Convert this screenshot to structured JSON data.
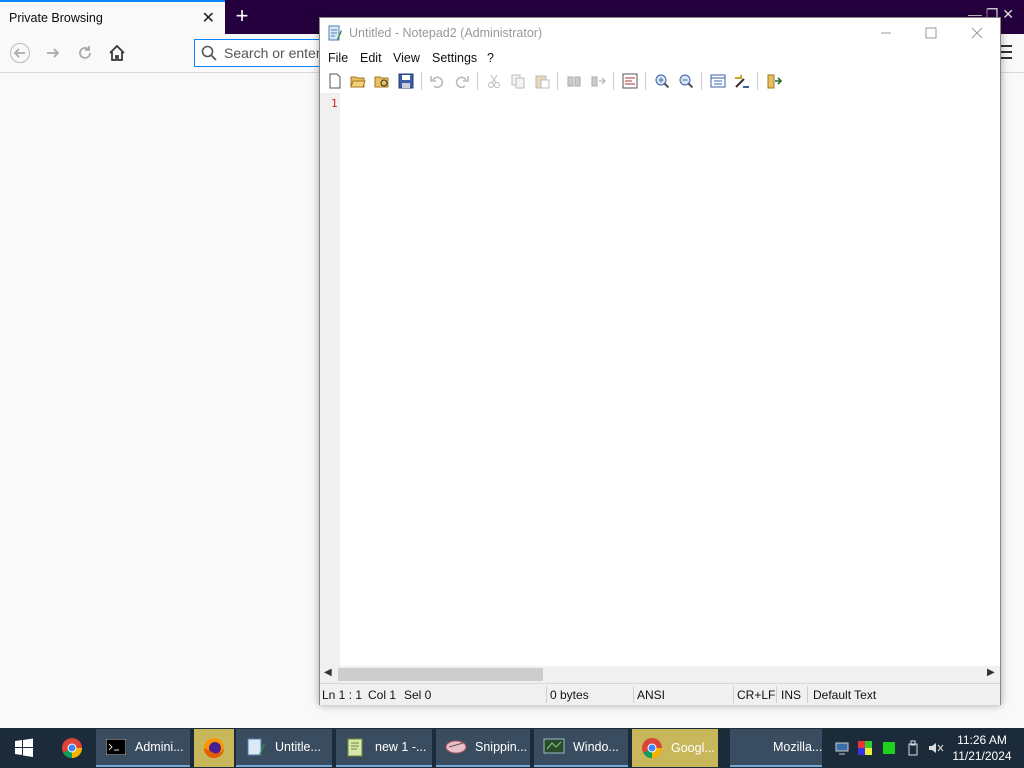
{
  "firefox": {
    "tab_title": "Private Browsing",
    "tab_close": "✕",
    "new_tab": "+",
    "window_controls": "—   ❐   ✕",
    "urlbar_placeholder": "Search or enter address"
  },
  "notepad": {
    "title": "Untitled - Notepad2 (Administrator)",
    "menu": [
      "File",
      "Edit",
      "View",
      "Settings",
      "?"
    ],
    "toolbar_icons": [
      "new-file-icon",
      "open-file-icon",
      "browse-icon",
      "save-icon",
      "undo-icon",
      "redo-icon",
      "cut-icon",
      "copy-icon",
      "paste-icon",
      "find-icon",
      "replace-icon",
      "word-wrap-icon",
      "zoom-in-icon",
      "zoom-out-icon",
      "view-scheme-icon",
      "customize-icon",
      "exit-icon"
    ],
    "gutter_line": "1",
    "status": {
      "position": "Ln 1 : 1",
      "column": "Col 1",
      "selection": "Sel 0",
      "size": "0 bytes",
      "encoding": "ANSI",
      "line_endings": "CR+LF",
      "mode": "INS",
      "scheme": "Default Text"
    }
  },
  "taskbar": {
    "items": [
      {
        "label": "Admini...",
        "icon": "cmd-icon"
      },
      {
        "label": "",
        "icon": "firefox-icon"
      },
      {
        "label": "Untitle...",
        "icon": "notepad2-icon"
      },
      {
        "label": "new 1 -...",
        "icon": "notepadpp-icon"
      },
      {
        "label": "Snippin...",
        "icon": "snipping-tool-icon"
      },
      {
        "label": "Windo...",
        "icon": "windows-explorer-icon"
      },
      {
        "label": "Googl...",
        "icon": "chrome-icon"
      },
      {
        "label": "Mozilla...",
        "icon": "firefox-window-icon"
      }
    ],
    "clock_time": "11:26 AM",
    "clock_date": "11/21/2024"
  },
  "colors": {
    "firefox_private_titlebar": "#25003e",
    "firefox_accent": "#0a84ff",
    "taskbar": "#1c2b3a",
    "taskbar_active": "#c8b85b",
    "line_number": "#d02020"
  }
}
